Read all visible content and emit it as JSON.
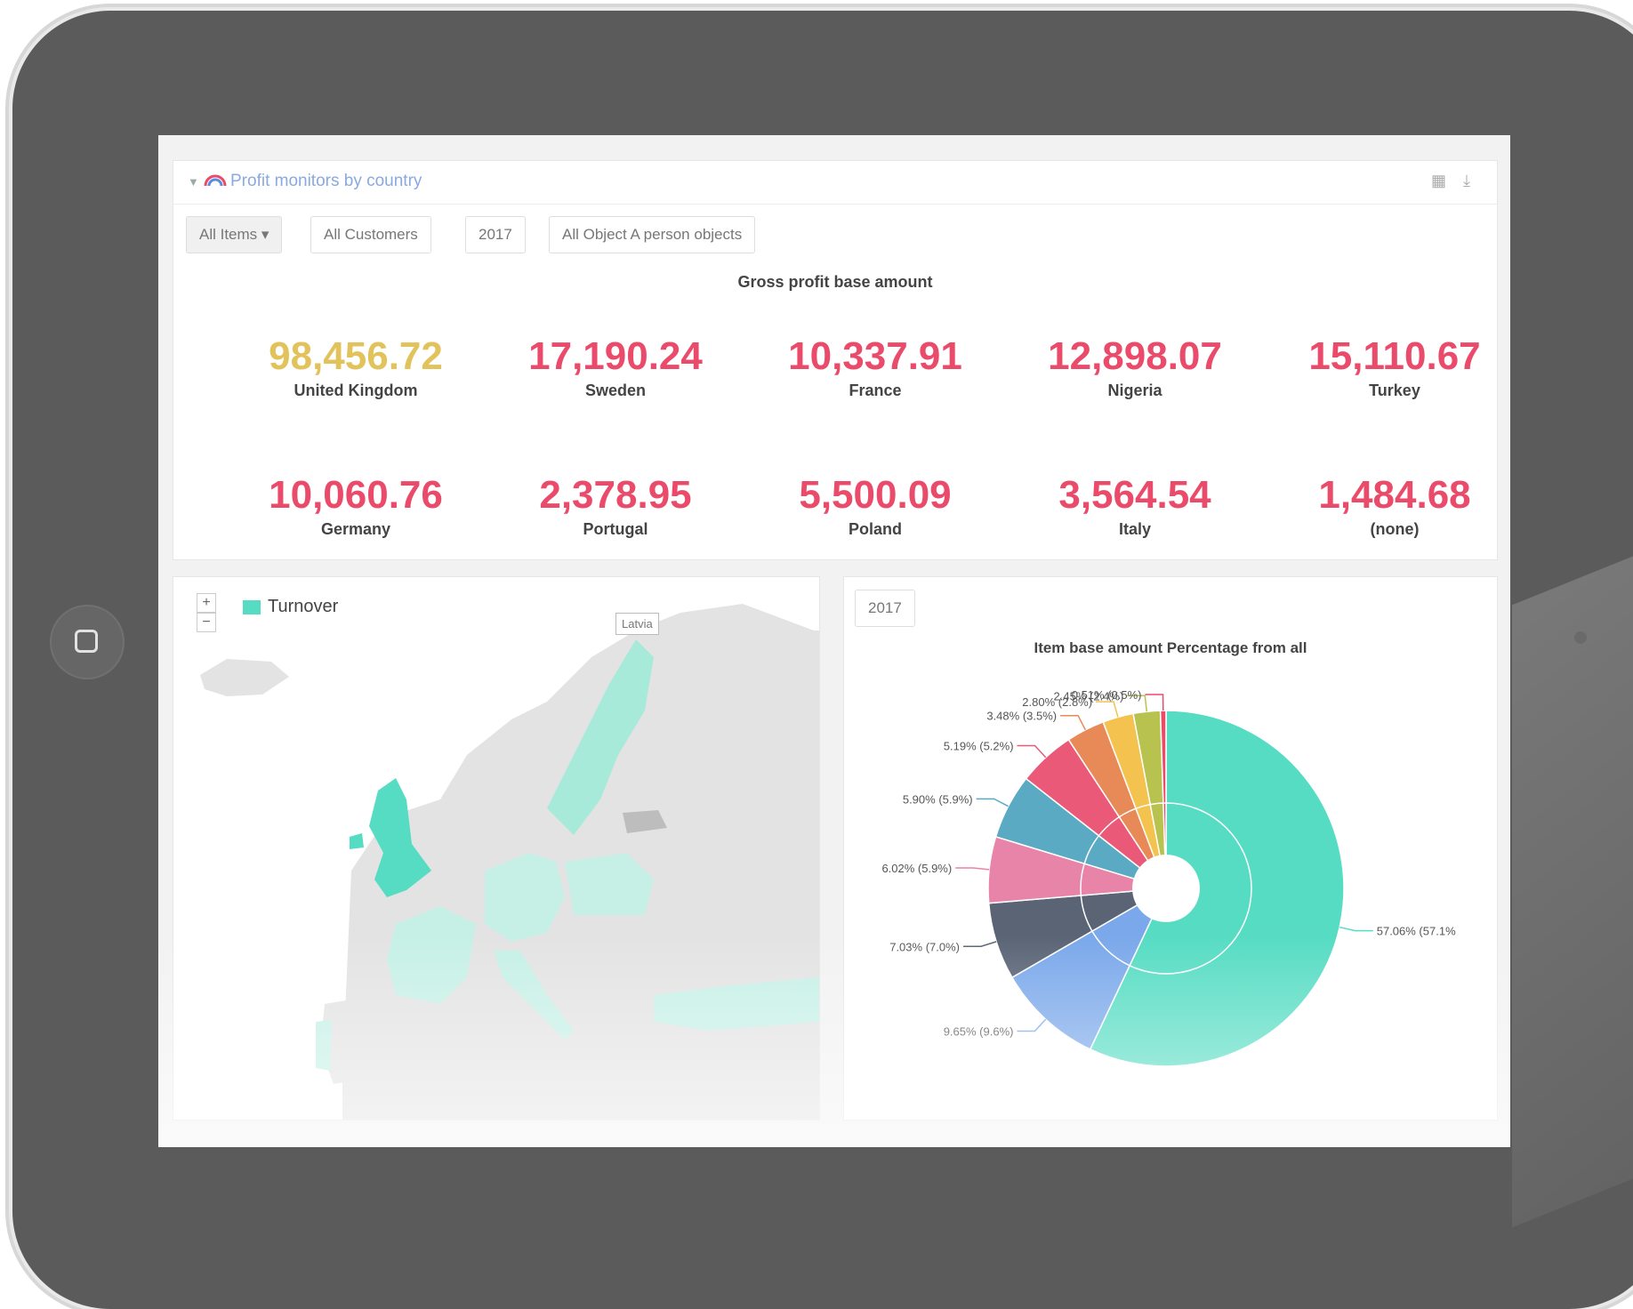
{
  "dashboard": {
    "title": "Profit monitors by country",
    "filters": [
      "All Items ▾",
      "All Customers",
      "2017",
      "All Object A person objects"
    ],
    "kpi_title": "Gross profit base amount",
    "kpis": [
      {
        "value": "98,456.72",
        "country": "United Kingdom",
        "color": "#e2c25a"
      },
      {
        "value": "17,190.24",
        "country": "Sweden",
        "color": "#ea4b6a"
      },
      {
        "value": "10,337.91",
        "country": "France",
        "color": "#ea4b6a"
      },
      {
        "value": "12,898.07",
        "country": "Nigeria",
        "color": "#ea4b6a"
      },
      {
        "value": "15,110.67",
        "country": "Turkey",
        "color": "#ea4b6a"
      },
      {
        "value": "10,060.76",
        "country": "Germany",
        "color": "#ea4b6a"
      },
      {
        "value": "2,378.95",
        "country": "Portugal",
        "color": "#ea4b6a"
      },
      {
        "value": "5,500.09",
        "country": "Poland",
        "color": "#ea4b6a"
      },
      {
        "value": "3,564.54",
        "country": "Italy",
        "color": "#ea4b6a"
      },
      {
        "value": "1,484.68",
        "country": "(none)",
        "color": "#ea4b6a"
      }
    ]
  },
  "map": {
    "zoom_in": "+",
    "zoom_out": "−",
    "legend": "Turnover",
    "tooltip": "Latvia",
    "color": "#56dcc3"
  },
  "pie": {
    "filter": "2017",
    "title": "Item base amount Percentage from all",
    "chart_data": {
      "type": "pie",
      "title": "Item base amount Percentage from all",
      "slices": [
        {
          "value": 57.06,
          "label": "57.06% (57.1%",
          "color": "#56dcc3"
        },
        {
          "value": 9.65,
          "label": "9.65% (9.6%)",
          "color": "#7aa8ea"
        },
        {
          "value": 7.03,
          "label": "7.03% (7.0%)",
          "color": "#5a6475"
        },
        {
          "value": 6.02,
          "label": "6.02% (5.9%)",
          "color": "#e884a8"
        },
        {
          "value": 5.9,
          "label": "5.90% (5.9%)",
          "color": "#5baac3"
        },
        {
          "value": 5.19,
          "label": "5.19% (5.2%)",
          "color": "#ea5a78"
        },
        {
          "value": 3.48,
          "label": "3.48% (3.5%)",
          "color": "#e88a58"
        },
        {
          "value": 2.8,
          "label": "2.80% (2.8%)",
          "color": "#f4c24e"
        },
        {
          "value": 2.45,
          "label": "2.45% (2.4%)",
          "color": "#b8c24e"
        },
        {
          "value": 0.51,
          "label": "0.51% (0.5%)",
          "color": "#ea4b6a"
        }
      ]
    }
  }
}
